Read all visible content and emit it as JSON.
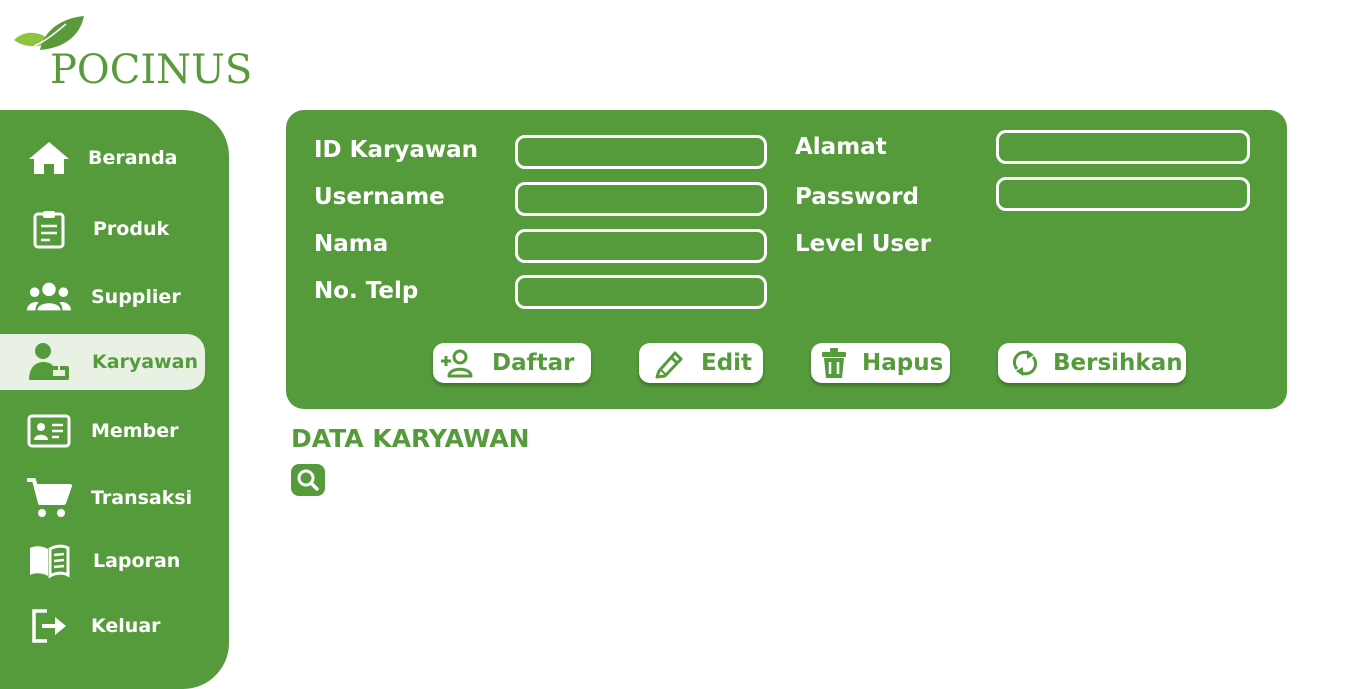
{
  "app": {
    "brand": "POCINUS",
    "colors": {
      "primary": "#559b3c",
      "active_bg": "#e8f1e3",
      "text_on_primary": "#ffffff"
    }
  },
  "sidebar": {
    "items": [
      {
        "label": "Beranda",
        "icon": "home-icon"
      },
      {
        "label": "Produk",
        "icon": "clipboard-icon"
      },
      {
        "label": "Supplier",
        "icon": "users-icon"
      },
      {
        "label": "Karyawan",
        "icon": "employee-icon",
        "active": true
      },
      {
        "label": "Member",
        "icon": "id-card-icon"
      },
      {
        "label": "Transaksi",
        "icon": "cart-icon"
      },
      {
        "label": "Laporan",
        "icon": "book-icon"
      },
      {
        "label": "Keluar",
        "icon": "logout-icon"
      }
    ]
  },
  "form": {
    "id_karyawan": {
      "label": "ID Karyawan",
      "value": ""
    },
    "username": {
      "label": "Username",
      "value": ""
    },
    "nama": {
      "label": "Nama",
      "value": ""
    },
    "no_telp": {
      "label": "No. Telp",
      "value": ""
    },
    "alamat": {
      "label": "Alamat",
      "value": ""
    },
    "password": {
      "label": "Password",
      "value": ""
    },
    "level_user": {
      "label": "Level User"
    }
  },
  "actions": {
    "daftar": "Daftar",
    "edit": "Edit",
    "hapus": "Hapus",
    "bersihkan": "Bersihkan"
  },
  "data_section": {
    "title": "DATA KARYAWAN",
    "search_icon": "search-icon"
  }
}
